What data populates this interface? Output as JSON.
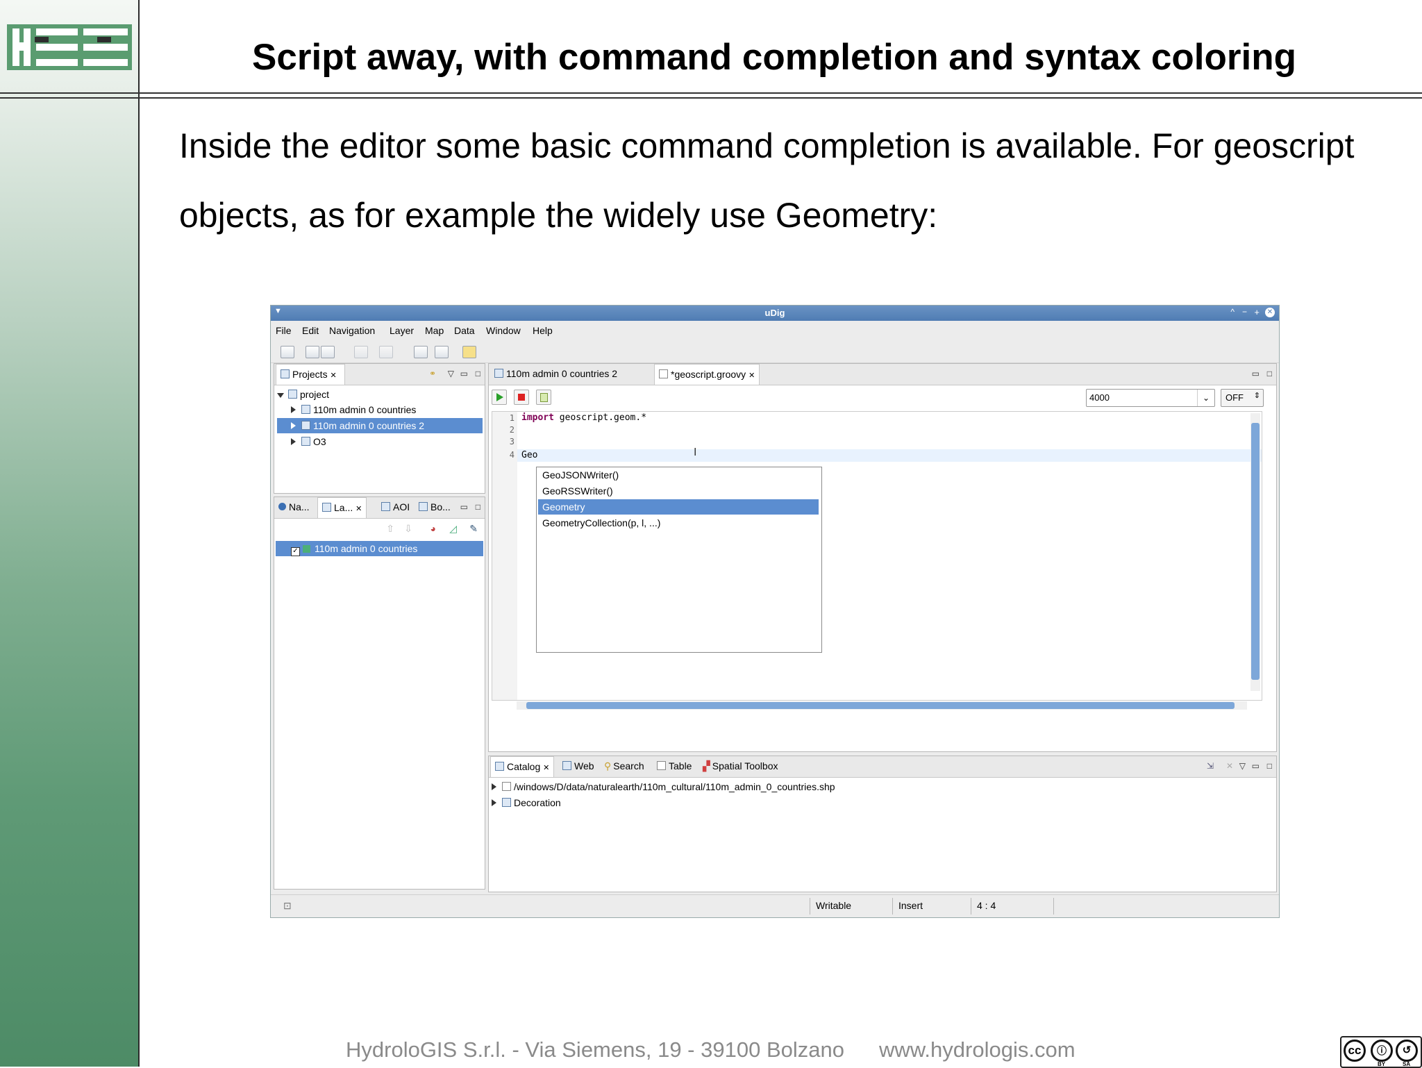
{
  "slide": {
    "title": "Script away, with command completion and syntax coloring",
    "intro_line1": "Inside the editor some basic command completion is available. For geoscript",
    "intro_line2": "objects, as for example the widely use Geometry:",
    "footer_address": "HydroloGIS S.r.l. - Via Siemens, 19 - 39100 Bolzano",
    "footer_url": "www.hydrologis.com",
    "license_by": "BY",
    "license_sa": "SA",
    "license_cc": "cc"
  },
  "window": {
    "title": "uDig",
    "controls": [
      "^",
      "−",
      "+",
      "✕"
    ]
  },
  "menu": [
    "File",
    "Edit",
    "Navigation",
    "Layer",
    "Map",
    "Data",
    "Window",
    "Help"
  ],
  "projects_panel": {
    "tab_label": "Projects",
    "root": "project",
    "items": [
      "110m admin 0 countries",
      "110m admin 0 countries 2",
      "O3"
    ],
    "selected_index": 1
  },
  "layers_panel": {
    "tabs": [
      "Na...",
      "La...",
      "AOI",
      "Bo..."
    ],
    "items": [
      "110m admin 0 countries"
    ]
  },
  "editor": {
    "tabs": [
      "110m admin 0 countries 2",
      "*geoscript.groovy"
    ],
    "active_tab": 1,
    "scale_value": "4000",
    "toggle_value": "OFF",
    "lines": [
      {
        "num": "1",
        "keyword": "import",
        "text": " geoscript.geom.*"
      },
      {
        "num": "2",
        "keyword": "",
        "text": ""
      },
      {
        "num": "3",
        "keyword": "",
        "text": ""
      },
      {
        "num": "4",
        "keyword": "",
        "text": "Geo"
      }
    ],
    "completions": [
      "GeoJSONWriter()",
      "GeoRSSWriter()",
      "Geometry",
      "GeometryCollection(p, l, ...)"
    ],
    "selected_completion": 2
  },
  "bottom_panel": {
    "tabs": [
      "Catalog",
      "Web",
      "Search",
      "Table",
      "Spatial Toolbox"
    ],
    "items": [
      "/windows/D/data/naturalearth/110m_cultural/110m_admin_0_countries.shp",
      "Decoration"
    ]
  },
  "statusbar": {
    "mode": "Writable",
    "insert": "Insert",
    "position": "4 : 4"
  },
  "colors": {
    "titlebar": "#4f7cb3",
    "selection": "#5b8dd0",
    "keyword": "#7f0055",
    "band": "#5f9a76"
  }
}
